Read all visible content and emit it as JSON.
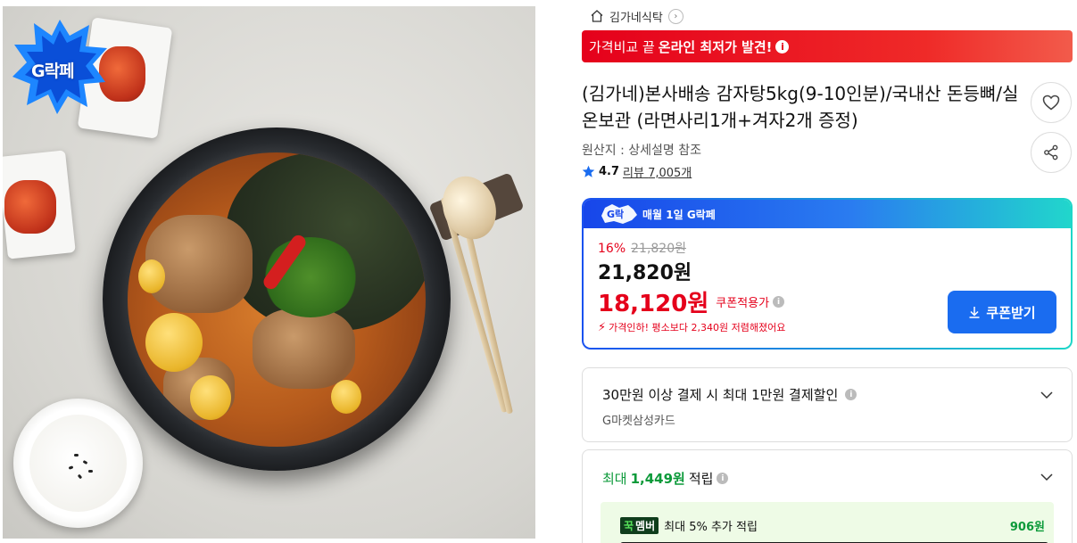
{
  "breadcrumb": {
    "store": "김가네식탁"
  },
  "promo_bar": {
    "prefix": "가격비교 끝",
    "highlight": "온라인 최저가 발견!"
  },
  "badge": {
    "main_text": "G락페",
    "event_text": "매월 1일 G락페"
  },
  "product": {
    "title": "(김가네)본사배송 감자탕5kg(9-10인분)/국내산 돈등뼈/실온보관 (라면사리1개+겨자2개 증정)",
    "origin": "원산지 : 상세설명 참조",
    "rating": "4.7",
    "review_label": "리뷰",
    "review_count": "7,005개"
  },
  "price": {
    "discount_pct": "16%",
    "original": "21,820원",
    "regular": "21,820원",
    "coupon_price": "18,120원",
    "coupon_label": "쿠폰적용가",
    "drop_note": "가격인하! 평소보다 2,340원 저렴해졌어요",
    "coupon_button": "쿠폰받기"
  },
  "benefits": {
    "card_discount_title": "30만원 이상 결제 시 최대 1만원 결제할인",
    "card_discount_sub": "G마켓삼성카드",
    "points_prefix": "최대",
    "points_amount": "1,449원",
    "points_suffix": "적립",
    "member_tag_g": "꾹",
    "member_tag_text": "멤버",
    "member_desc": "최대 5% 추가 적립",
    "member_amount": "906원"
  },
  "colors": {
    "promo_red": "#e5001b",
    "accent_blue": "#1a6cf0",
    "points_green": "#0c9a3a"
  },
  "icons": [
    "home-icon",
    "chevron-right-icon",
    "info-icon",
    "heart-icon",
    "share-icon",
    "star-icon",
    "bolt-icon",
    "download-icon",
    "chevron-down-icon"
  ]
}
